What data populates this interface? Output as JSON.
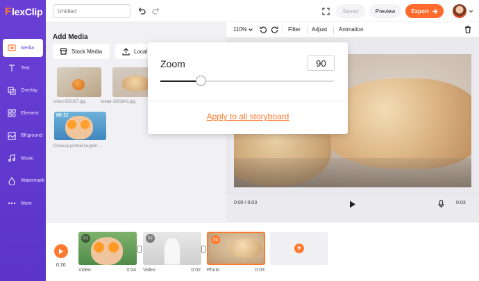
{
  "app": {
    "brand_icon": "F",
    "brand_text": "lexClip"
  },
  "sidebar": {
    "items": [
      {
        "label": "Media",
        "icon": "media-icon",
        "active": true
      },
      {
        "label": "Text",
        "icon": "text-icon"
      },
      {
        "label": "Overlay",
        "icon": "overlay-icon"
      },
      {
        "label": "Element",
        "icon": "element-icon"
      },
      {
        "label": "BKground",
        "icon": "background-icon"
      },
      {
        "label": "Music",
        "icon": "music-icon"
      },
      {
        "label": "Watermark",
        "icon": "watermark-icon"
      },
      {
        "label": "More",
        "icon": "more-icon"
      }
    ]
  },
  "topbar": {
    "project_title_placeholder": "Untitled",
    "saved_label": "Saved",
    "preview_label": "Preview",
    "export_label": "Export"
  },
  "media": {
    "title": "Add Media",
    "tabs": [
      {
        "label": "Stock Media"
      },
      {
        "label": "Local"
      }
    ],
    "items": [
      {
        "caption": "onion-932167.jpg"
      },
      {
        "caption": "bread-1081841.jpg"
      },
      {
        "caption": "Closeup portrait laughin...",
        "duration": "00:11"
      }
    ]
  },
  "editor": {
    "zoom_level": "110%",
    "tools": [
      "Filter",
      "Adjust",
      "Animation"
    ],
    "current_time": "0:00 / 0:03",
    "end_time": "0:03"
  },
  "zoom_popup": {
    "label": "Zoom",
    "value": "90",
    "slider_fraction": 0.23,
    "apply_label": "Apply to all storyboard"
  },
  "timeline": {
    "time": "0:10",
    "clips": [
      {
        "num": "01",
        "type": "Video",
        "duration": "0:04"
      },
      {
        "num": "02",
        "type": "Video",
        "duration": "0:02"
      },
      {
        "num": "03",
        "type": "Photo",
        "duration": "0:03",
        "selected": true
      }
    ]
  },
  "colors": {
    "accent": "#ff6b2c",
    "sidebar": "#6a3fd6"
  }
}
